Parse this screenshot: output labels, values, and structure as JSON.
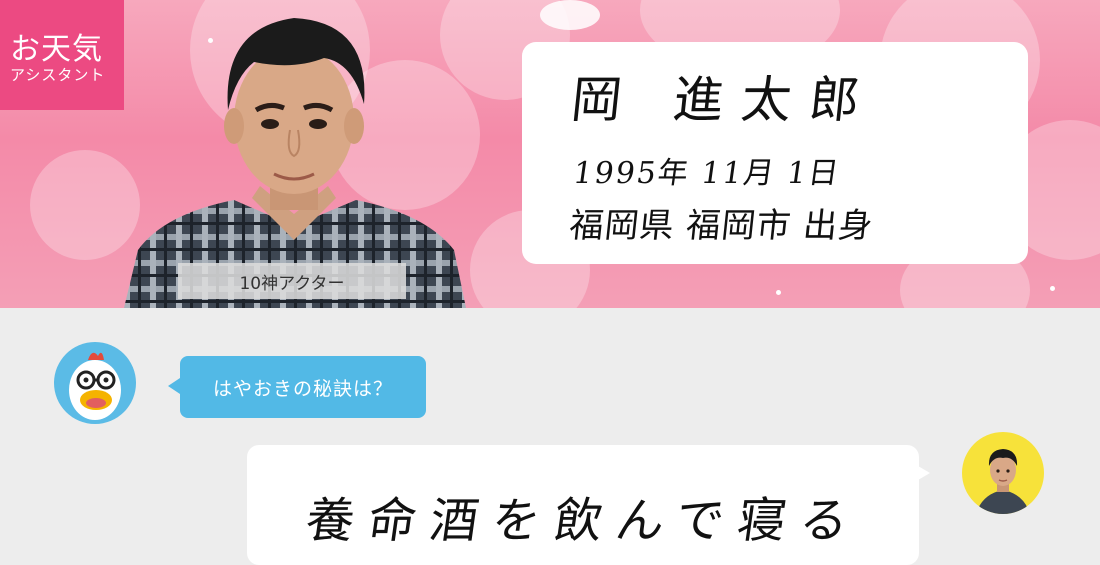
{
  "header": {
    "badge": {
      "title": "お天気",
      "subtitle": "アシスタント"
    },
    "caption": "10神アクター",
    "profile": {
      "name": "岡 進太郎",
      "birth": "1995年 11月 1日",
      "origin": "福岡県 福岡市 出身"
    }
  },
  "chat": {
    "question": "はやおきの秘訣は？",
    "answer": "養命酒を飲んで寝る"
  },
  "icons": {
    "bot_avatar": "mascot-bird-icon",
    "user_avatar": "user-photo-icon"
  },
  "colors": {
    "badge_bg": "#ec4a82",
    "header_bg": "#f48aa8",
    "question_bubble": "#52b9e6",
    "user_avatar_bg": "#f7e23a",
    "page_bg": "#ededed"
  }
}
